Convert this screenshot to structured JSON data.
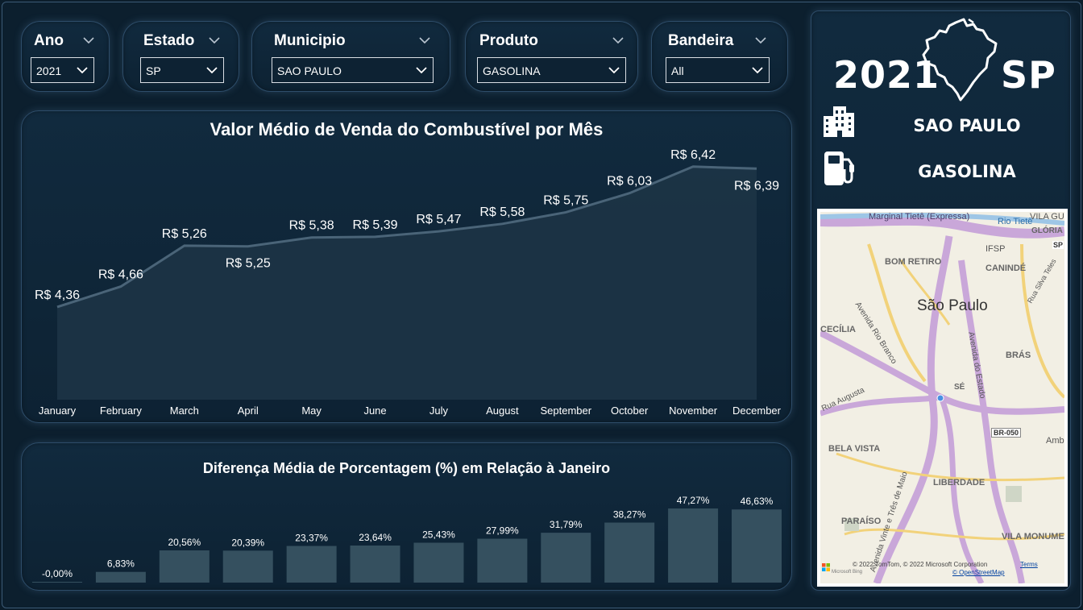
{
  "filters": {
    "ano": {
      "label": "Ano",
      "value": "2021"
    },
    "estado": {
      "label": "Estado",
      "value": "SP"
    },
    "municipio": {
      "label": "Municipio",
      "value": "SAO PAULO"
    },
    "produto": {
      "label": "Produto",
      "value": "GASOLINA"
    },
    "bandeira": {
      "label": "Bandeira",
      "value": "All"
    }
  },
  "kpi": {
    "year": "2021",
    "state": "SP",
    "municipio": "SAO PAULO",
    "produto": "GASOLINA"
  },
  "chart_data": [
    {
      "type": "area",
      "title": "Valor Médio de Venda do Combustível por Mês",
      "categories": [
        "January",
        "February",
        "March",
        "April",
        "May",
        "June",
        "July",
        "August",
        "September",
        "October",
        "November",
        "December"
      ],
      "values": [
        4.36,
        4.66,
        5.26,
        5.25,
        5.38,
        5.39,
        5.47,
        5.58,
        5.75,
        6.03,
        6.42,
        6.39
      ],
      "data_labels": [
        "R$ 4,36",
        "R$ 4,66",
        "R$ 5,26",
        "R$ 5,25",
        "R$ 5,38",
        "R$ 5,39",
        "R$ 5,47",
        "R$ 5,58",
        "R$ 5,75",
        "R$ 6,03",
        "R$ 6,42",
        "R$ 6,39"
      ],
      "color": "#4a6478"
    },
    {
      "type": "bar",
      "title": "Diferença Média de Porcentagem (%) em Relação à Janeiro",
      "categories": [
        "January",
        "February",
        "March",
        "April",
        "May",
        "June",
        "July",
        "August",
        "September",
        "October",
        "November",
        "December"
      ],
      "values": [
        0.0,
        6.83,
        20.56,
        20.39,
        23.37,
        23.64,
        25.43,
        27.99,
        31.79,
        38.27,
        47.27,
        46.63
      ],
      "data_labels": [
        "-0,00%",
        "6,83%",
        "20,56%",
        "20,39%",
        "23,37%",
        "23,64%",
        "25,43%",
        "27,99%",
        "31,79%",
        "38,27%",
        "47,27%",
        "46,63%"
      ],
      "color": "#35505f"
    }
  ],
  "map": {
    "city_label": "São Paulo",
    "labels": [
      "Marginal Tietê (Expressa)",
      "Rio Tietê",
      "VILA GU",
      "IFSP",
      "BOM RETIRO",
      "CANINDÉ",
      "Avenida Rio Branco",
      "Rua Silva Teles",
      "CECÍLIA",
      "Avenida do Estado",
      "BRÁS",
      "SÉ",
      "Rua Augusta",
      "BR-050",
      "Ambev",
      "BELA VISTA",
      "LIBERDADE",
      "Avenida Vinte e Três de Maio",
      "PARAÍSO",
      "VILA MONUME",
      "GLÓRIA",
      "SP"
    ],
    "attribution": "© 2022 TomTom, © 2022 Microsoft Corporation",
    "terms": "Terms",
    "osm": "© OpenStreetMap",
    "bing": "Microsoft Bing"
  },
  "colors": {
    "background": "#0c1f2e",
    "card": "#112a3e",
    "border": "#2e4d6a",
    "area_fill": "#1d3446",
    "line": "#4a6478",
    "bar": "#35505f"
  }
}
